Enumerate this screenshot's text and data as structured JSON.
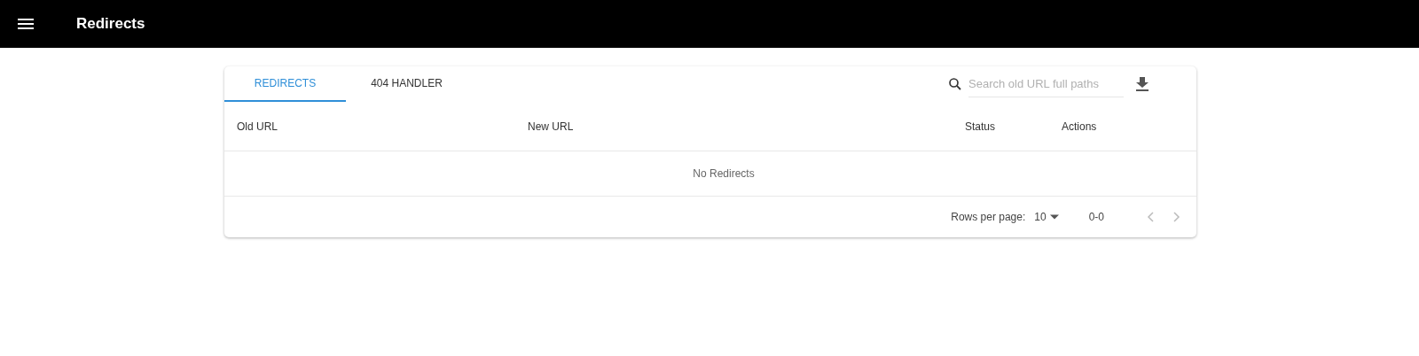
{
  "app_bar": {
    "title": "Redirects"
  },
  "tabs": [
    {
      "label": "REDIRECTS",
      "selected": true
    },
    {
      "label": "404 HANDLER",
      "selected": false
    }
  ],
  "search": {
    "placeholder": "Search old URL full paths"
  },
  "table": {
    "columns": [
      "Old URL",
      "New URL",
      "Status",
      "Actions"
    ],
    "empty_message": "No Redirects"
  },
  "pagination": {
    "rows_per_page_label": "Rows per page:",
    "rows_per_page": "10",
    "range": "0-0",
    "previous_disabled": true,
    "next_disabled": true
  }
}
